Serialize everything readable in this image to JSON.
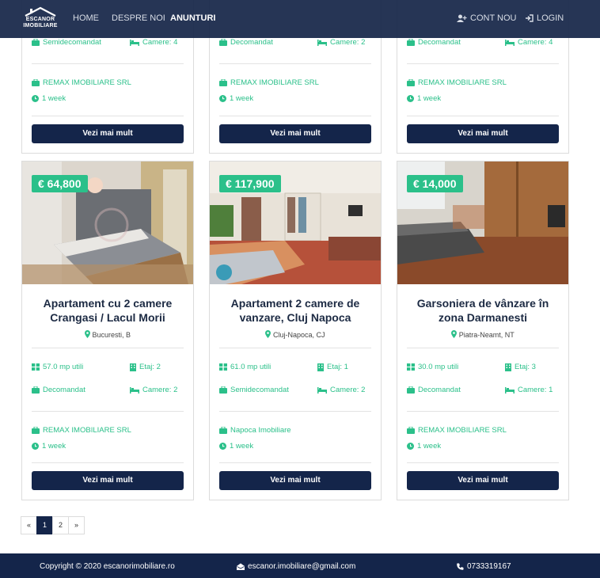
{
  "nav": {
    "logo_text_1": "ESCANOR",
    "logo_text_2": "IMOBILIARE",
    "home": "HOME",
    "about": "DESPRE NOI",
    "listings": "ANUNTURI",
    "contact": "CONT NOU",
    "login": "LOGIN"
  },
  "top_row": [
    {
      "layout": "Semidecomandat",
      "rooms": "Camere: 4",
      "agency": "REMAX IMOBILIARE SRL",
      "time": "1 week",
      "button": "Vezi mai mult"
    },
    {
      "layout": "Decomandat",
      "rooms": "Camere: 2",
      "agency": "REMAX IMOBILIARE SRL",
      "time": "1 week",
      "button": "Vezi mai mult"
    },
    {
      "layout": "Decomandat",
      "rooms": "Camere: 4",
      "agency": "REMAX IMOBILIARE SRL",
      "time": "1 week",
      "button": "Vezi mai mult"
    }
  ],
  "cards": [
    {
      "price": "€ 64,800",
      "title_1": "Apartament cu 2 camere",
      "title_2": "Crangasi / Lacul Morii",
      "location": "Bucuresti, B",
      "area": "57.0 mp utili",
      "floor": "Etaj: 2",
      "layout": "Decomandat",
      "rooms": "Camere: 2",
      "agency": "REMAX IMOBILIARE SRL",
      "time": "1 week",
      "button": "Vezi mai mult"
    },
    {
      "price": "€ 117,900",
      "title_1": "Apartament 2 camere de",
      "title_2": "vanzare, Cluj Napoca",
      "location": "Cluj-Napoca, CJ",
      "area": "61.0 mp utili",
      "floor": "Etaj: 1",
      "layout": "Semidecomandat",
      "rooms": "Camere: 2",
      "agency": "Napoca Imobiliare",
      "time": "1 week",
      "button": "Vezi mai mult"
    },
    {
      "price": "€ 14,000",
      "title_1": "Garsoniera de vânzare în",
      "title_2": "zona Darmanesti",
      "location": "Piatra-Neamt, NT",
      "area": "30.0 mp utili",
      "floor": "Etaj: 3",
      "layout": "Decomandat",
      "rooms": "Camere: 1",
      "agency": "REMAX IMOBILIARE SRL",
      "time": "1 week",
      "button": "Vezi mai mult"
    }
  ],
  "pagination": {
    "prev": "«",
    "pages": [
      "1",
      "2"
    ],
    "next": "»",
    "active": "1"
  },
  "footer": {
    "copyright": "Copyright © 2020 escanorimobiliare.ro",
    "email": "escanor.imobiliare@gmail.com",
    "phone": "0733319167"
  },
  "colors": {
    "navy": "#14254a",
    "accent": "#2bc08a"
  }
}
